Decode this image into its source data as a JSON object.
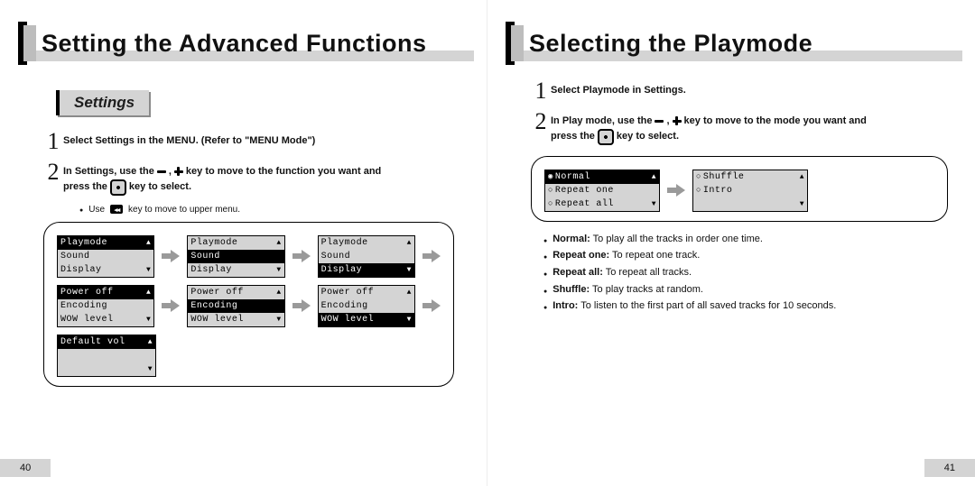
{
  "left": {
    "title": "Setting the Advanced Functions",
    "section": "Settings",
    "step1": "Select Settings in the MENU. (Refer to \"MENU Mode\")",
    "step2a": "In Settings, use the",
    "step2b": "key to move to the function you want and",
    "step2c": "press the",
    "step2d": "key to select.",
    "note_a": "Use",
    "note_b": "key to move to upper menu.",
    "menus": {
      "group1": [
        {
          "items": [
            "Playmode",
            "Sound",
            "Display"
          ],
          "selected": 0
        },
        {
          "items": [
            "Playmode",
            "Sound",
            "Display"
          ],
          "selected": 1
        },
        {
          "items": [
            "Playmode",
            "Sound",
            "Display"
          ],
          "selected": 2
        }
      ],
      "group2": [
        {
          "items": [
            "Power off",
            "Encoding",
            "WOW level"
          ],
          "selected": 0
        },
        {
          "items": [
            "Power off",
            "Encoding",
            "WOW level"
          ],
          "selected": 1
        },
        {
          "items": [
            "Power off",
            "Encoding",
            "WOW level"
          ],
          "selected": 2
        }
      ],
      "single": {
        "items": [
          "Default vol",
          "",
          ""
        ],
        "selected": 0
      }
    },
    "pagenum": "40"
  },
  "right": {
    "title": "Selecting the Playmode",
    "step1": "Select Playmode in Settings.",
    "step2a": "In Play mode, use the",
    "step2b": "key to move to the mode you want and",
    "step2c": "press the",
    "step2d": "key to select.",
    "menuA": {
      "items": [
        "Normal",
        "Repeat one",
        "Repeat all"
      ],
      "selected": 0
    },
    "menuB": {
      "items": [
        "Shuffle",
        "Intro",
        ""
      ],
      "selected": -1
    },
    "descs": [
      {
        "term": "Normal:",
        "text": " To play all the tracks in order one time."
      },
      {
        "term": "Repeat one:",
        "text": " To repeat one track."
      },
      {
        "term": "Repeat all:",
        "text": " To repeat all tracks."
      },
      {
        "term": "Shuffle:",
        "text": " To play tracks at random."
      },
      {
        "term": "Intro:",
        "text": " To listen to the first part of all saved tracks for 10 seconds."
      }
    ],
    "pagenum": "41"
  }
}
